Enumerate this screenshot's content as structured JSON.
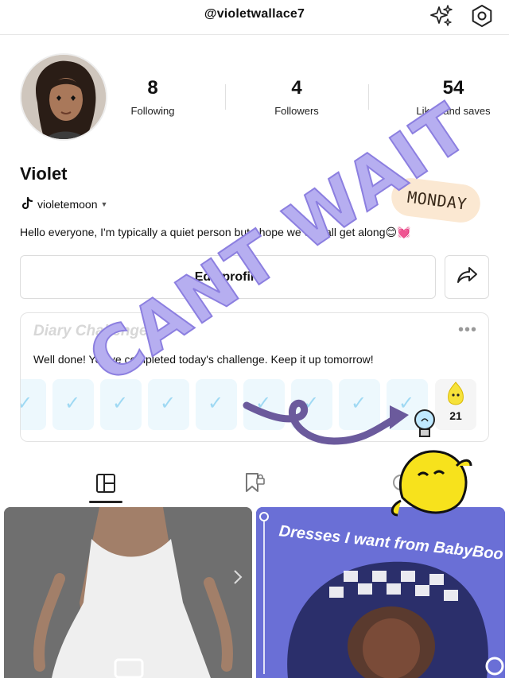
{
  "header": {
    "username": "@violetwallace7"
  },
  "stats": [
    {
      "value": "8",
      "label": "Following"
    },
    {
      "value": "4",
      "label": "Followers"
    },
    {
      "value": "54",
      "label": "Likes and saves"
    }
  ],
  "profile": {
    "name": "Violet",
    "tiktok_handle": "violetemoon",
    "bio": "Hello everyone, I'm typically a quiet person but I hope we can all get along😊💓"
  },
  "sticker": {
    "monday": "MONDAY"
  },
  "actions": {
    "edit_profile": "Edit profile"
  },
  "diary": {
    "title": "Diary Challenge",
    "message": "Well done! You've completed today's challenge. Keep it up tomorrow!",
    "streak": "21",
    "completed_days": 9
  },
  "overlay": {
    "text": "CANT WAIT"
  },
  "posts": [
    {
      "caption": ""
    },
    {
      "caption": "Dresses I want from BabyBoo"
    }
  ],
  "colors": {
    "accent_purple": "#b6aef0",
    "check_blue": "#9fd9f3",
    "sticker_peach": "#fbe8d2"
  }
}
